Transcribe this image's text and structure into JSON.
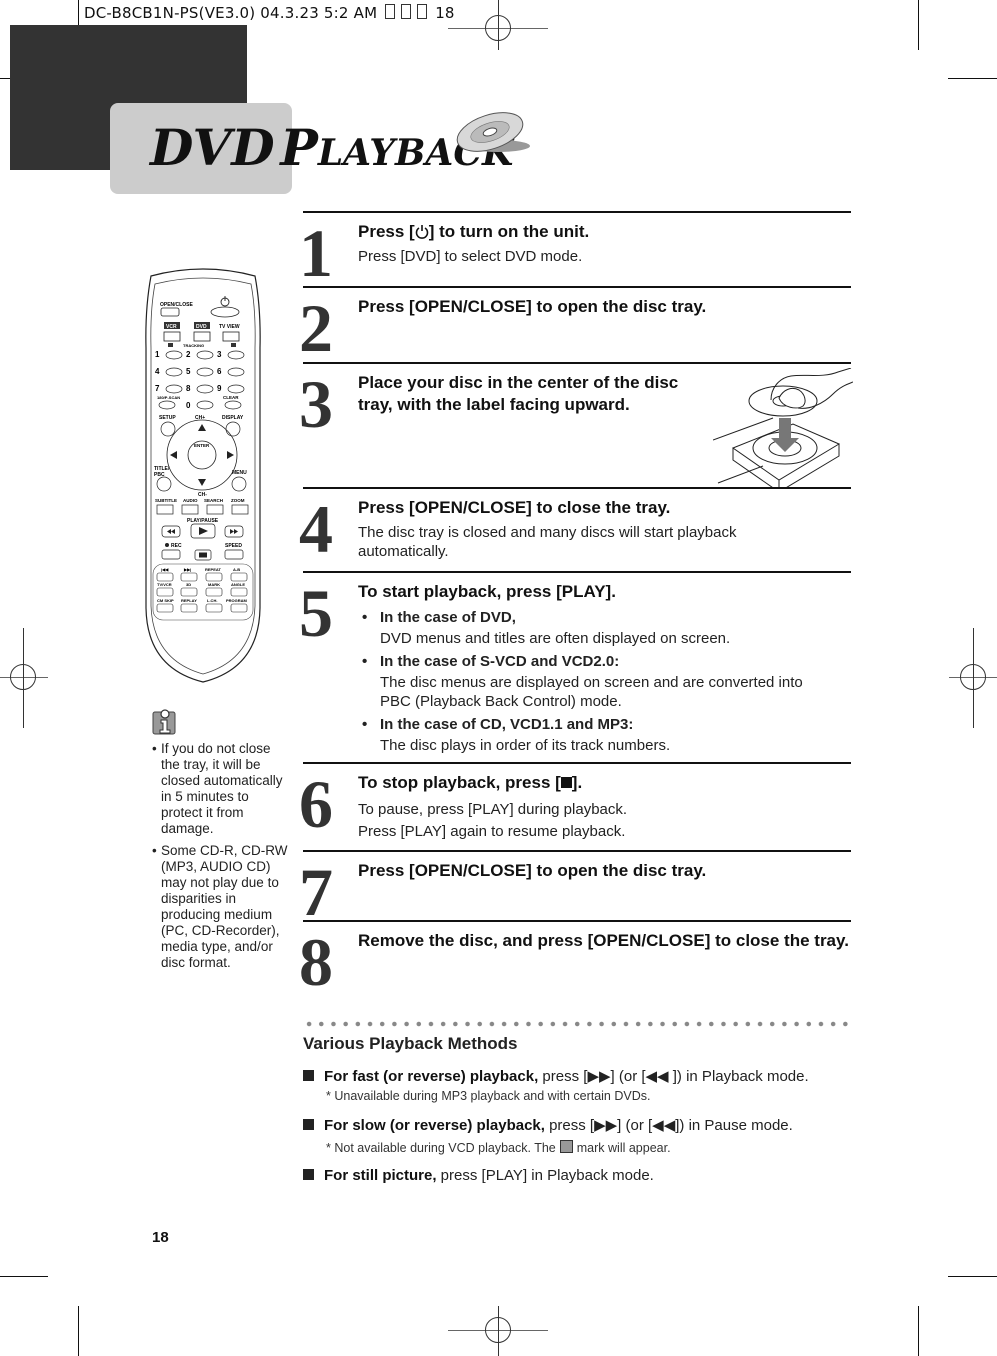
{
  "slug": {
    "text": "DC-B8CB1N-PS(VE3.0)   04.3.23 5:2 AM",
    "page_ref": "18"
  },
  "header": {
    "title_first": "DVD",
    "title_second_initial": "P",
    "title_second_rest": "LAYBACK"
  },
  "steps": [
    {
      "number": "1",
      "heading_pre": "Press [",
      "heading_post": "] to turn on the unit.",
      "lines": [
        "Press [DVD] to select DVD mode."
      ]
    },
    {
      "number": "2",
      "heading": "Press [OPEN/CLOSE] to open the disc tray."
    },
    {
      "number": "3",
      "heading_line1": "Place your disc in the center of the disc",
      "heading_line2": "tray, with the label facing upward."
    },
    {
      "number": "4",
      "heading": "Press [OPEN/CLOSE] to close the tray.",
      "lines": [
        "The disc tray is closed and many discs will start playback",
        "automatically."
      ]
    },
    {
      "number": "5",
      "heading": "To start playback, press [PLAY].",
      "bullets": [
        {
          "title": "In the case of DVD,",
          "lines": [
            "DVD menus and titles are often displayed on screen."
          ]
        },
        {
          "title": "In the case of S-VCD and VCD2.0:",
          "lines": [
            "The disc menus are displayed on screen and are converted into",
            "PBC (Playback Back Control) mode."
          ]
        },
        {
          "title": "In the case of CD, VCD1.1 and MP3:",
          "lines": [
            "The disc plays in order of its track numbers."
          ]
        }
      ]
    },
    {
      "number": "6",
      "heading_pre": "To stop playback,  press [",
      "heading_post": "].",
      "lines": [
        "To pause, press [PLAY] during playback.",
        "Press [PLAY] again to resume playback."
      ]
    },
    {
      "number": "7",
      "heading": "Press [OPEN/CLOSE] to open the disc tray."
    },
    {
      "number": "8",
      "heading": "Remove the disc, and press [OPEN/CLOSE] to close the tray."
    }
  ],
  "remote": {
    "labels": {
      "open_close": "OPEN/CLOSE",
      "vcr": "VCR",
      "dvd": "DVD",
      "tv_view": "TV VIEW",
      "tracking": "TRACKING",
      "n1": "1",
      "n2": "2",
      "n3": "3",
      "n4": "4",
      "n5": "5",
      "n6": "6",
      "n7": "7",
      "n8": "8",
      "n9": "9",
      "n0": "0",
      "pscan": "180/P-SCAN",
      "clear": "CLEAR",
      "setup": "SETUP",
      "ch_plus": "CH+",
      "display": "DISPLAY",
      "enter": "ENTER",
      "title_pbc_1": "TITLE/",
      "title_pbc_2": "PBC",
      "menu": "MENU",
      "ch_minus": "CH-",
      "subtitle": "SUBTITLE",
      "audio": "AUDIO",
      "search": "SEARCH",
      "zoom": "ZOOM",
      "play_pause": "PLAY/PAUSE",
      "rec": "REC",
      "speed": "SPEED",
      "repeat": "REPEAT",
      "ab": "A-B",
      "tv_vcr": "TV/VCR",
      "three_d": "3D",
      "mark": "MARK",
      "angle": "ANGLE",
      "cm_skip": "CM SKIP",
      "replay": "REPLAY",
      "lch": "L.CH.",
      "program": "PROGRAM"
    }
  },
  "notes": [
    "If you do not close the tray, it will be closed automatically in 5 minutes to protect it from damage.",
    "Some CD-R, CD-RW (MP3, AUDIO CD) may not play due to disparities in producing medium (PC, CD-Recorder), media type, and/or disc format."
  ],
  "various": {
    "title": "Various Playback Methods",
    "items": [
      {
        "bold": "For fast (or reverse) playback,",
        "text": " press [▶▶] (or [◀◀ ]) in  Playback mode.",
        "note": "* Unavailable during MP3 playback and with certain DVDs."
      },
      {
        "bold": "For slow (or reverse) playback,",
        "text": " press [▶▶] (or [◀◀]) in Pause mode.",
        "note_pre": "* Not available during VCD playback. The",
        "note_post": "mark will appear."
      },
      {
        "bold": "For still picture,",
        "text": " press [PLAY] in Playback mode."
      }
    ]
  },
  "footer": {
    "page_number": "18"
  }
}
